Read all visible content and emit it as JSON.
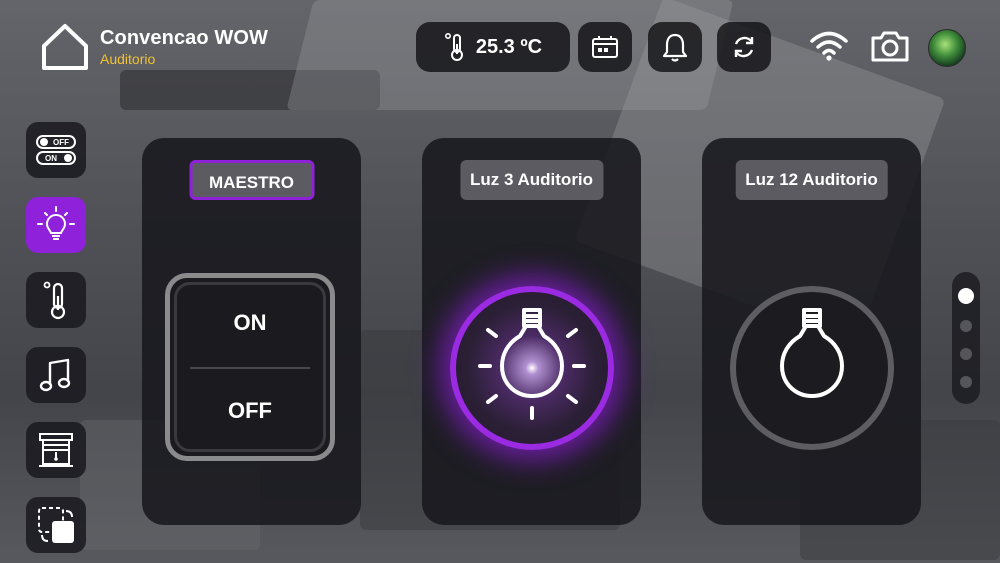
{
  "header": {
    "title": "Convencao WOW",
    "subtitle": "Auditorio",
    "temperature": "25.3 ºC"
  },
  "sidebar": {
    "items": [
      {
        "name": "on-off-scenes",
        "off_text": "OFF",
        "on_text": "ON",
        "active": false
      },
      {
        "name": "lighting",
        "active": true
      },
      {
        "name": "climate",
        "active": false
      },
      {
        "name": "music",
        "active": false
      },
      {
        "name": "shades",
        "active": false
      },
      {
        "name": "screens",
        "active": false
      }
    ]
  },
  "cards": {
    "maestro": {
      "label": "MAESTRO",
      "on_label": "ON",
      "off_label": "OFF"
    },
    "light1": {
      "label": "Luz 3 Auditorio",
      "state": "on"
    },
    "light2": {
      "label": "Luz 12 Auditorio",
      "state": "off"
    }
  },
  "pager": {
    "pages": 4,
    "current": 1
  },
  "colors": {
    "accent": "#8e21d9",
    "subtitle": "#f2c12e",
    "panel": "#18181e"
  }
}
